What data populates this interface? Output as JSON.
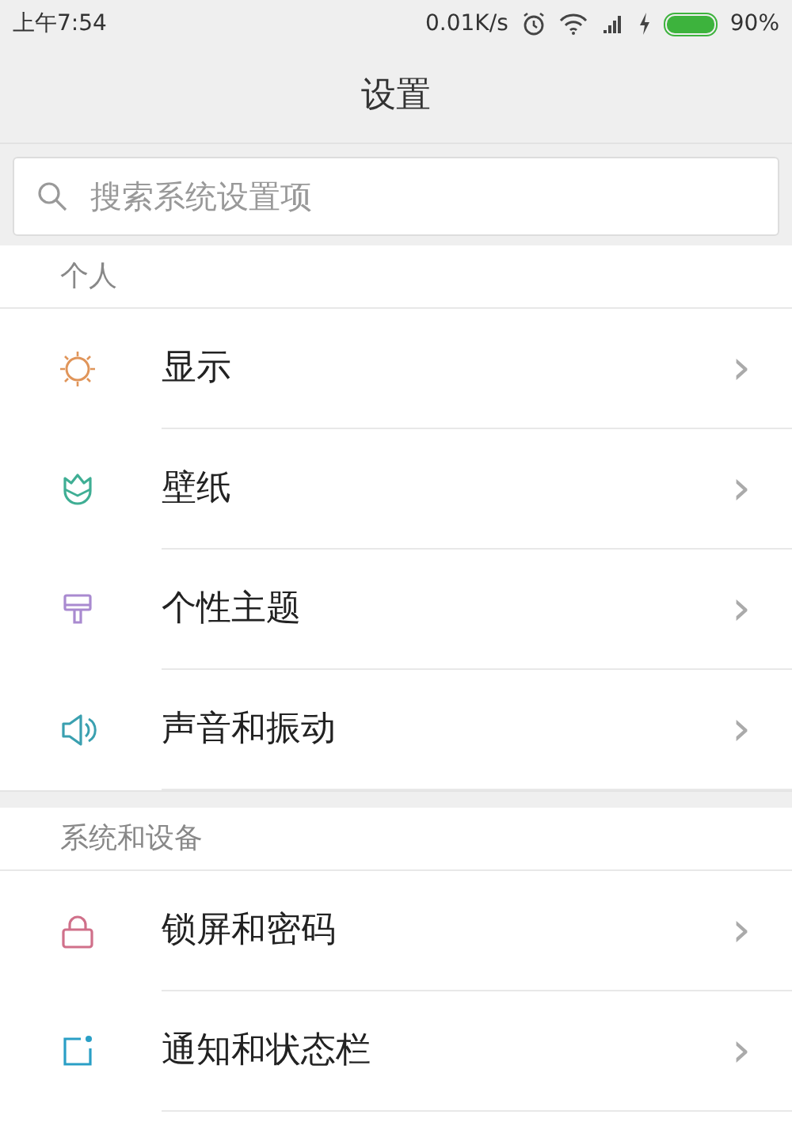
{
  "status_bar": {
    "time": "上午7:54",
    "speed": "0.01K/s",
    "battery": "90%"
  },
  "title": "设置",
  "search": {
    "placeholder": "搜索系统设置项"
  },
  "sections": [
    {
      "header": "个人",
      "items": [
        {
          "label": "显示",
          "chevron": "›"
        },
        {
          "label": "壁纸",
          "chevron": "›"
        },
        {
          "label": "个性主题",
          "chevron": "›"
        },
        {
          "label": "声音和振动",
          "chevron": "›"
        }
      ]
    },
    {
      "header": "系统和设备",
      "items": [
        {
          "label": "锁屏和密码",
          "chevron": "›"
        },
        {
          "label": "通知和状态栏",
          "chevron": "›"
        }
      ]
    }
  ]
}
